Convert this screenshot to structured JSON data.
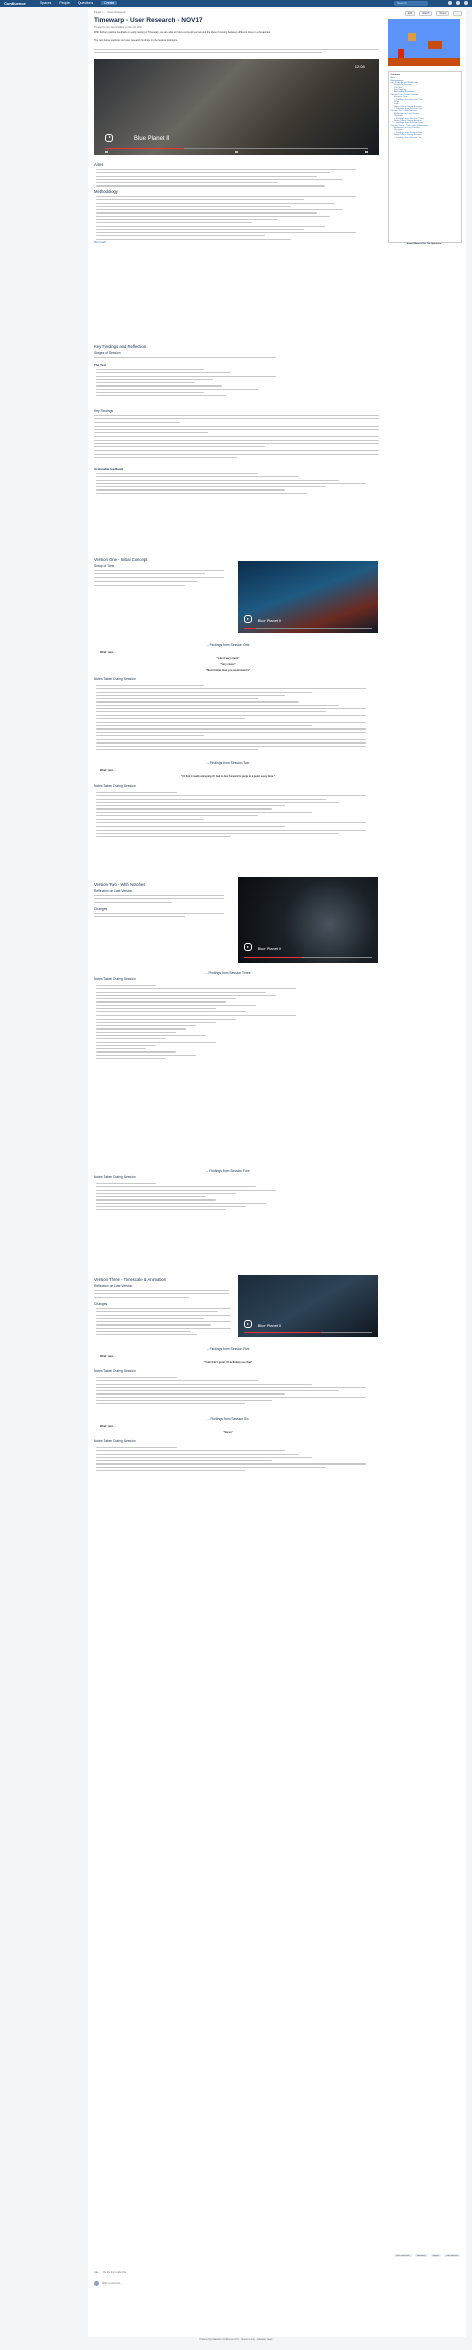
{
  "nav": {
    "logo": "Confluence",
    "menu": [
      "Spaces",
      "People",
      "Questions",
      "Create"
    ],
    "search_placeholder": "Search"
  },
  "page": {
    "breadcrumb": "Pages / … / User Research",
    "title": "Timewarp - User Research - NOV17",
    "byline": "Created by NV, last modified on Nov 24, 2017",
    "actions": [
      "Edit",
      "Watch",
      "Share",
      "…"
    ],
    "intro": "With further positive feedback on early testing of Timewarp, we are able to hold a concept test around the idea of moving between different times in a broadcast.",
    "intro2": "The test below explores our user research findings on the feature prototype.",
    "video_title": "Blue Planet II",
    "video_clock": "12:08"
  },
  "sections": {
    "aims": "Aims",
    "methodology": "Methodology",
    "methodology_link": "Miro board",
    "key_findings": "Key Findings and Reflection",
    "stages": "Stages of Session",
    "the_test": "The Test",
    "key_findings_h": "Key Findings",
    "actionable": "Actionable feedback",
    "v1": "Version One - Initial Concept",
    "setup": "Setup of Time",
    "findings_s1": "-- Findings from Session One",
    "what": "What:",
    "said": "said...",
    "quote1": "\"Like it very much\"",
    "quote2": "\"Very clever\"",
    "quote3": "\"Much better than you understand it\"",
    "notes_taken": "Notes Taken During Session",
    "findings_s2": "-- Findings from Session Two",
    "quote4": "\"I'd find it really annoying if I had to fast forward to jump to a point every time.\"",
    "v2": "Version Two - With Notches",
    "reflection": "Reflection on Last Version",
    "changes": "Changes",
    "findings_s3": "-- Findings from Session Three",
    "findings_s4": "-- Findings from Session Four",
    "v3": "Version Three - Timescale & Animation",
    "findings_s5": "-- Findings from Session Five",
    "quote5": "\"Yeah that's great, I'd definitely use that\"",
    "findings_s6": "-- Findings from Session Six",
    "quote6": "\"Saves\""
  },
  "toc": {
    "heading": "Contents",
    "items": [
      "Aims",
      "Methodology",
      "Key Findings and Reflection",
      "Stages of Session",
      "The Test",
      "Key Findings",
      "Actionable Feedback",
      "Version One - Initial Concept",
      "Setup of Time",
      "-- Findings from Session One",
      "What",
      "said...",
      "Notes Taken During Session",
      "-- Findings from Session Two",
      "Version Two - With Notches",
      "Reflection on Last Version",
      "Changes",
      "-- Findings from Session Three",
      "Notes Taken During Session",
      "-- Findings from Session Four",
      "Version Three - Timescale & Animation",
      "Reflection on Last Version",
      "Changes",
      "-- Findings from Session Five",
      "Notes Taken During Session",
      "-- Findings from Session Six"
    ]
  },
  "side_caption": "Sound Material for The Spectrum",
  "labels": [
    "user-research",
    "timewarp",
    "iplayer",
    "concept-test"
  ],
  "footer": {
    "like": "Like",
    "be_first": "Be the first to like this",
    "comment_placeholder": "Write a comment...",
    "powered": "Powered by Atlassian Confluence 6.5.1 · Report a bug · Atlassian News"
  }
}
